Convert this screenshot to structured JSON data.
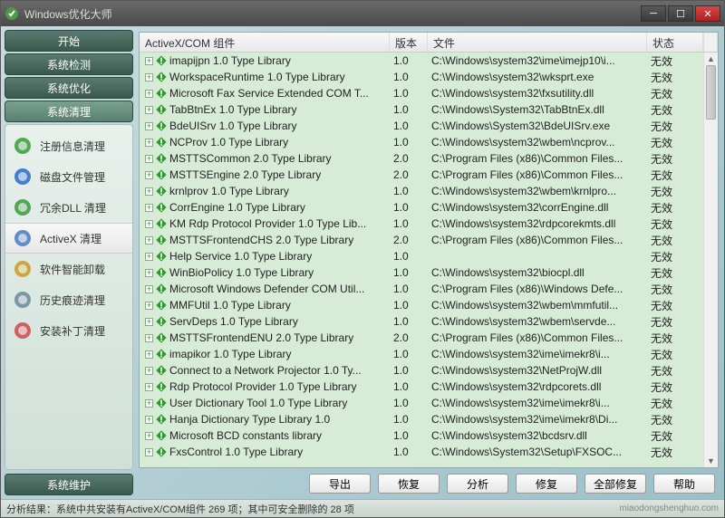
{
  "window": {
    "title": "Windows优化大师"
  },
  "winbtns": {
    "min": "─",
    "max": "☐",
    "close": "✕"
  },
  "sidebar": {
    "tabs": [
      "开始",
      "系统检测",
      "系统优化",
      "系统清理"
    ],
    "activeTab": 3,
    "items": [
      {
        "label": "注册信息清理",
        "icon": "registry-icon",
        "color": "#3a9a3a"
      },
      {
        "label": "磁盘文件管理",
        "icon": "disk-icon",
        "color": "#2a6ac8"
      },
      {
        "label": "冗余DLL 清理",
        "icon": "dll-icon",
        "color": "#3a9a3a"
      },
      {
        "label": "ActiveX 清理",
        "icon": "activex-icon",
        "color": "#4a7ac0",
        "selected": true
      },
      {
        "label": "软件智能卸载",
        "icon": "uninstall-icon",
        "color": "#c89a2a"
      },
      {
        "label": "历史痕迹清理",
        "icon": "history-icon",
        "color": "#6a8a9a"
      },
      {
        "label": "安装补丁清理",
        "icon": "patch-icon",
        "color": "#c84a4a"
      }
    ],
    "bottomTab": "系统维护"
  },
  "list": {
    "headers": {
      "name": "ActiveX/COM 组件",
      "ver": "版本",
      "file": "文件",
      "status": "状态"
    },
    "rows": [
      {
        "name": "imapijpn 1.0 Type Library",
        "ver": "1.0",
        "file": "C:\\Windows\\system32\\ime\\imejp10\\i...",
        "status": "无效"
      },
      {
        "name": "WorkspaceRuntime 1.0 Type Library",
        "ver": "1.0",
        "file": "C:\\Windows\\system32\\wksprt.exe",
        "status": "无效"
      },
      {
        "name": "Microsoft Fax Service Extended COM T...",
        "ver": "1.0",
        "file": "C:\\Windows\\system32\\fxsutility.dll",
        "status": "无效"
      },
      {
        "name": "TabBtnEx 1.0 Type Library",
        "ver": "1.0",
        "file": "C:\\Windows\\System32\\TabBtnEx.dll",
        "status": "无效"
      },
      {
        "name": "BdeUISrv 1.0 Type Library",
        "ver": "1.0",
        "file": "C:\\Windows\\System32\\BdeUISrv.exe",
        "status": "无效"
      },
      {
        "name": "NCProv 1.0 Type Library",
        "ver": "1.0",
        "file": "C:\\Windows\\system32\\wbem\\ncprov...",
        "status": "无效"
      },
      {
        "name": "MSTTSCommon 2.0 Type Library",
        "ver": "2.0",
        "file": "C:\\Program Files (x86)\\Common Files...",
        "status": "无效"
      },
      {
        "name": "MSTTSEngine 2.0 Type Library",
        "ver": "2.0",
        "file": "C:\\Program Files (x86)\\Common Files...",
        "status": "无效"
      },
      {
        "name": "krnlprov 1.0 Type Library",
        "ver": "1.0",
        "file": "C:\\Windows\\system32\\wbem\\krnlpro...",
        "status": "无效"
      },
      {
        "name": "CorrEngine 1.0 Type Library",
        "ver": "1.0",
        "file": "C:\\Windows\\system32\\corrEngine.dll",
        "status": "无效"
      },
      {
        "name": "KM Rdp Protocol Provider 1.0 Type Lib...",
        "ver": "1.0",
        "file": "C:\\Windows\\system32\\rdpcorekmts.dll",
        "status": "无效"
      },
      {
        "name": "MSTTSFrontendCHS 2.0 Type Library",
        "ver": "2.0",
        "file": "C:\\Program Files (x86)\\Common Files...",
        "status": "无效"
      },
      {
        "name": "Help Service 1.0 Type Library",
        "ver": "1.0",
        "file": "",
        "status": "无效"
      },
      {
        "name": "WinBioPolicy 1.0 Type Library",
        "ver": "1.0",
        "file": "C:\\Windows\\system32\\biocpl.dll",
        "status": "无效"
      },
      {
        "name": "Microsoft Windows Defender COM Util...",
        "ver": "1.0",
        "file": "C:\\Program Files (x86)\\Windows Defe...",
        "status": "无效"
      },
      {
        "name": "MMFUtil 1.0 Type Library",
        "ver": "1.0",
        "file": "C:\\Windows\\system32\\wbem\\mmfutil...",
        "status": "无效"
      },
      {
        "name": "ServDeps 1.0 Type Library",
        "ver": "1.0",
        "file": "C:\\Windows\\system32\\wbem\\servde...",
        "status": "无效"
      },
      {
        "name": "MSTTSFrontendENU 2.0 Type Library",
        "ver": "2.0",
        "file": "C:\\Program Files (x86)\\Common Files...",
        "status": "无效"
      },
      {
        "name": "imapikor 1.0 Type Library",
        "ver": "1.0",
        "file": "C:\\Windows\\system32\\ime\\imekr8\\i...",
        "status": "无效"
      },
      {
        "name": "Connect to a Network Projector 1.0 Ty...",
        "ver": "1.0",
        "file": "C:\\Windows\\system32\\NetProjW.dll",
        "status": "无效"
      },
      {
        "name": "Rdp Protocol Provider 1.0 Type Library",
        "ver": "1.0",
        "file": "C:\\Windows\\system32\\rdpcorets.dll",
        "status": "无效"
      },
      {
        "name": "User Dictionary Tool 1.0 Type Library",
        "ver": "1.0",
        "file": "C:\\Windows\\system32\\ime\\imekr8\\i...",
        "status": "无效"
      },
      {
        "name": "Hanja Dictionary Type Library 1.0",
        "ver": "1.0",
        "file": "C:\\Windows\\system32\\ime\\imekr8\\Di...",
        "status": "无效"
      },
      {
        "name": "Microsoft BCD constants library",
        "ver": "1.0",
        "file": "C:\\Windows\\system32\\bcdsrv.dll",
        "status": "无效"
      },
      {
        "name": "FxsControl 1.0 Type Library",
        "ver": "1.0",
        "file": "C:\\Windows\\System32\\Setup\\FXSOC...",
        "status": "无效"
      }
    ]
  },
  "buttons": [
    "导出",
    "恢复",
    "分析",
    "修复",
    "全部修复",
    "帮助"
  ],
  "statusbar": {
    "text": "分析结果：系统中共安装有ActiveX/COM组件 269 项；其中可安全删除的 28 项",
    "watermark": "miaodongshenghuo.com"
  }
}
